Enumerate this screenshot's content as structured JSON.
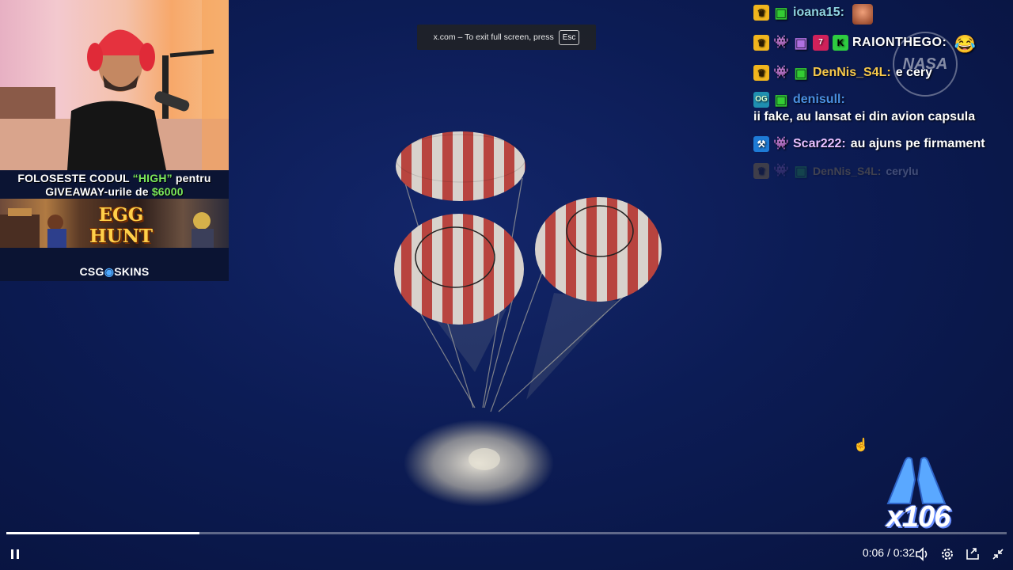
{
  "fullscreen_hint": {
    "text": "x.com – To exit full screen, press",
    "key": "Esc"
  },
  "promo": {
    "line1_prefix": "FOLOSESTE CODUL ",
    "line1_code": "“HIGH”",
    "line1_suffix": " pentru",
    "line2_prefix": "GIVEAWAY-urile de ",
    "line2_amount": "$6000",
    "banner_title": "EGG HUNT",
    "brand_left": "CSG",
    "brand_right": "SKINS"
  },
  "chat": {
    "messages": [
      {
        "user": "ioana15:",
        "text": ""
      },
      {
        "user": "RAIONTHEGO:",
        "text": ""
      },
      {
        "user": "DenNis_S4L:",
        "text": "e cery"
      },
      {
        "user": "denisull:",
        "text": "ii fake, au lansat ei din avion capsula"
      },
      {
        "user": "Scar222:",
        "text": "au ajuns pe firmament"
      },
      {
        "user": "DenNis_S4L:",
        "text": "cerylu"
      }
    ]
  },
  "watermark": "NASA",
  "emote_counter": "x106",
  "player": {
    "time": "0:06 / 0:32",
    "progress": 0.193
  },
  "icons": [
    "pause-icon",
    "volume-icon",
    "settings-icon",
    "picture-in-picture-icon",
    "exit-fullscreen-icon",
    "hand-cursor-icon"
  ],
  "colors": {
    "background": "#0c1c55",
    "crown_badge": "#f1b51d",
    "promo_highlight": "#7be85a",
    "denisull": "#4a90e2",
    "dennis": "#f6c84b"
  }
}
